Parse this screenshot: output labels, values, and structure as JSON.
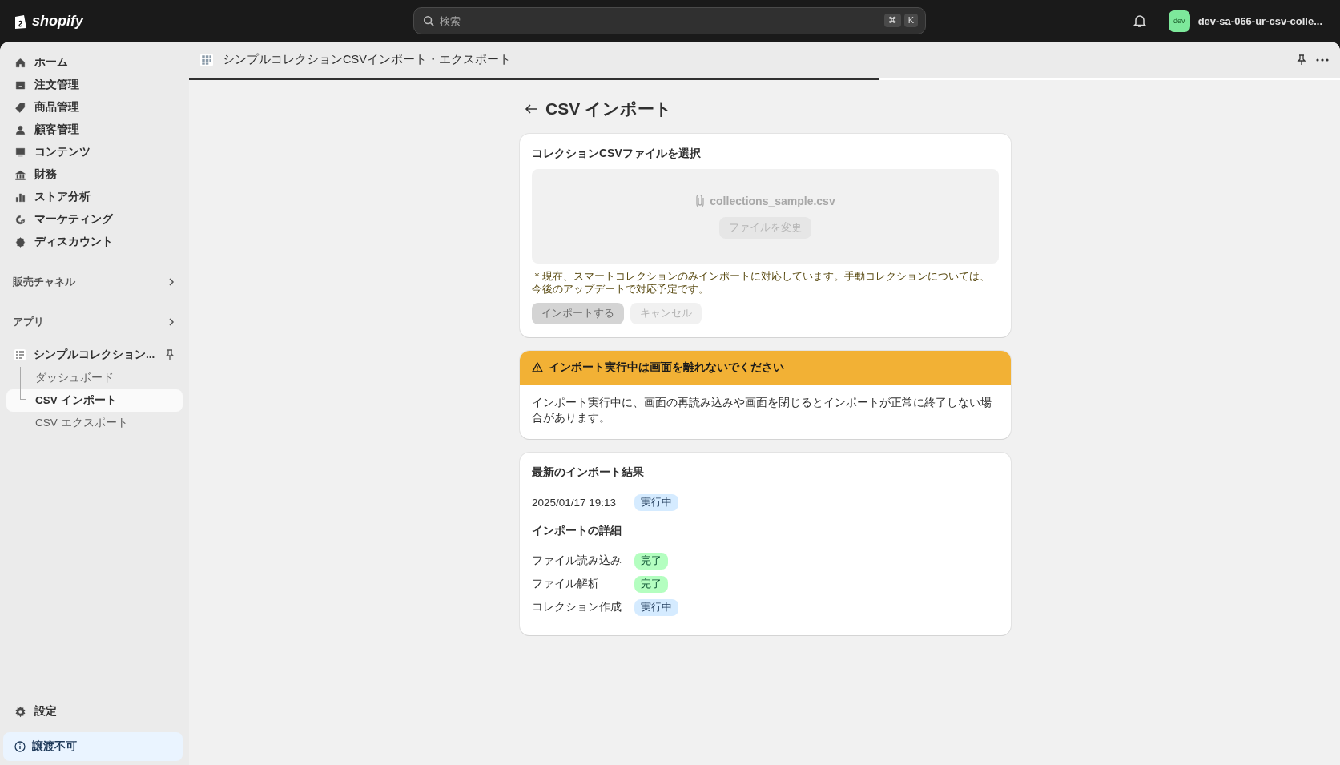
{
  "topbar": {
    "brand": "shopify",
    "search": {
      "placeholder": "検索",
      "shortcut": [
        "⌘",
        "K"
      ]
    },
    "store": {
      "avatar": "dev",
      "name": "dev-sa-066-ur-csv-colle..."
    }
  },
  "sidebar": {
    "items": [
      {
        "label": "ホーム",
        "selected": false
      },
      {
        "label": "注文管理",
        "selected": false
      },
      {
        "label": "商品管理",
        "selected": false
      },
      {
        "label": "顧客管理",
        "selected": false
      },
      {
        "label": "コンテンツ",
        "selected": false
      },
      {
        "label": "財務",
        "selected": false
      },
      {
        "label": "ストア分析",
        "selected": false
      },
      {
        "label": "マーケティング",
        "selected": false
      },
      {
        "label": "ディスカウント",
        "selected": false
      }
    ],
    "sections": [
      {
        "label": "販売チャネル"
      },
      {
        "label": "アプリ"
      }
    ],
    "app": {
      "label": "シンプルコレクション...",
      "children": [
        {
          "label": "ダッシュボード",
          "selected": false
        },
        {
          "label": "CSV インポート",
          "selected": true
        },
        {
          "label": "CSV エクスポート",
          "selected": false
        }
      ]
    },
    "settings": "設定",
    "notice": "譲渡不可"
  },
  "app_header": {
    "title": "シンプルコレクションCSVインポート・エクスポート",
    "loading": {
      "level": 0.6
    }
  },
  "page": {
    "title": "CSV インポート",
    "file_card": {
      "title": "コレクションCSVファイルを選択",
      "file_name": "collections_sample.csv",
      "change_button": {
        "label": "ファイルを変更",
        "disabled": true
      },
      "note": "＊現在、スマートコレクションのみインポートに対応しています。手動コレクションについては、今後のアップデートで対応予定です。",
      "buttons": [
        {
          "label": "インポートする",
          "kind": "primary",
          "disabled": true
        },
        {
          "label": "キャンセル",
          "kind": "secondary",
          "disabled": true
        }
      ]
    },
    "warning": {
      "title": "インポート実行中は画面を離れないでください",
      "body": "インポート実行中に、画面の再読み込みや画面を閉じるとインポートが正常に終了しない場合があります。"
    },
    "result_card": {
      "title": "最新のインポート結果",
      "date": "2025/01/17 19:13",
      "status": {
        "label": "実行中",
        "kind": "info"
      },
      "details_title": "インポートの詳細",
      "details": [
        {
          "label": "ファイル読み込み",
          "status": {
            "label": "完了",
            "kind": "success"
          }
        },
        {
          "label": "ファイル解析",
          "status": {
            "label": "完了",
            "kind": "success"
          }
        },
        {
          "label": "コレクション作成",
          "status": {
            "label": "実行中",
            "kind": "info"
          }
        }
      ]
    }
  }
}
